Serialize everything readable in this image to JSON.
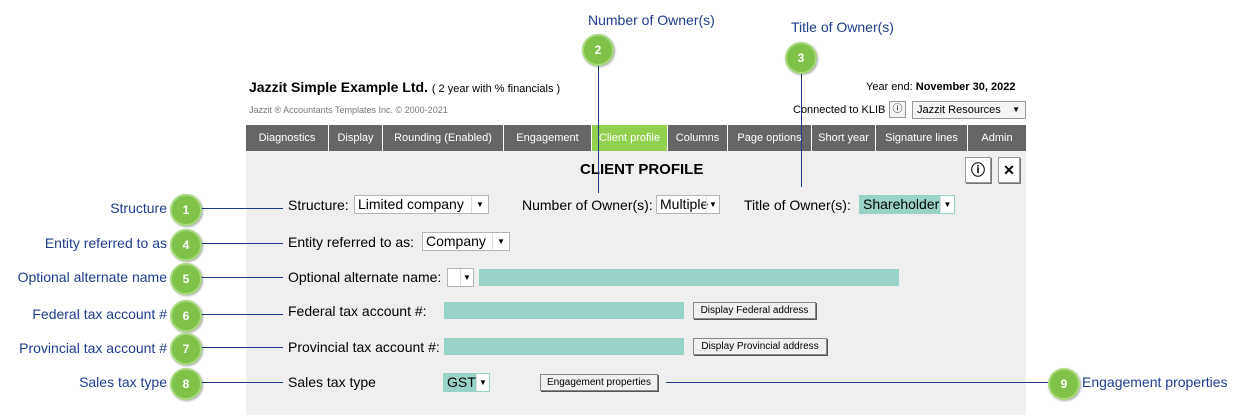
{
  "header": {
    "company": "Jazzit Simple Example Ltd.",
    "company_note": "( 2 year with % financials )",
    "copyright": "Jazzit ®  Accountants Templates Inc.  © 2000-2021",
    "year_end_label": "Year end:",
    "year_end_value": "November 30, 2022",
    "connected": "Connected to KLIB",
    "info_icon": "info-icon",
    "resources": "Jazzit Resources"
  },
  "tabs": [
    "Diagnostics",
    "Display",
    "Rounding (Enabled)",
    "Engagement",
    "Client profile",
    "Columns",
    "Page options",
    "Short year",
    "Signature lines",
    "Admin"
  ],
  "active_tab": "Client profile",
  "panel": {
    "title": "CLIENT PROFILE",
    "structure_label": "Structure:",
    "structure_value": "Limited company",
    "owners_label": "Number of Owner(s):",
    "owners_value": "Multiple",
    "title_owner_label": "Title of Owner(s):",
    "title_owner_value": "Shareholder",
    "entity_label": "Entity referred to as:",
    "entity_value": "Company",
    "alt_name_label": "Optional alternate name:",
    "alt_name_value": "",
    "federal_label": "Federal tax account #:",
    "federal_button": "Display Federal address",
    "provincial_label": "Provincial tax account #:",
    "provincial_button": "Display Provincial address",
    "sales_label": "Sales tax type",
    "sales_value": "GST",
    "engagement_button": "Engagement properties"
  },
  "callouts": {
    "c1": {
      "num": "1",
      "label": "Structure"
    },
    "c2": {
      "num": "2",
      "label": "Number of Owner(s)"
    },
    "c3": {
      "num": "3",
      "label": "Title of Owner(s)"
    },
    "c4": {
      "num": "4",
      "label": "Entity referred to as"
    },
    "c5": {
      "num": "5",
      "label": "Optional alternate name"
    },
    "c6": {
      "num": "6",
      "label": "Federal tax account #"
    },
    "c7": {
      "num": "7",
      "label": "Provincial tax account #"
    },
    "c8": {
      "num": "8",
      "label": "Sales tax type"
    },
    "c9": {
      "num": "9",
      "label": "Engagement properties"
    }
  },
  "colors": {
    "accent": "#92d050",
    "tab": "#666666",
    "field": "#99d3c7",
    "callout": "#1f3d8f"
  }
}
